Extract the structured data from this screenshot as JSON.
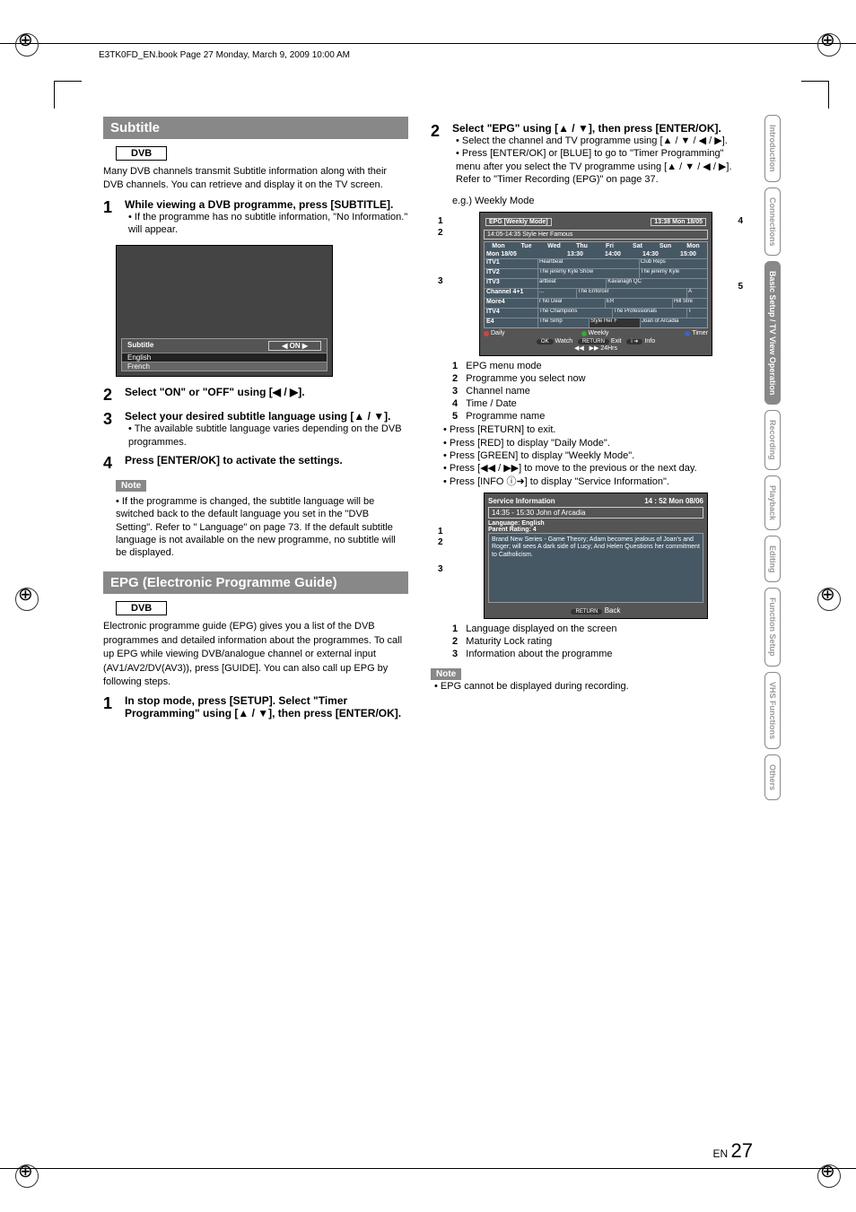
{
  "header": "E3TK0FD_EN.book  Page 27  Monday, March 9, 2009  10:00 AM",
  "left": {
    "section1_title": "Subtitle",
    "dvb": "DVB",
    "intro": "Many DVB channels transmit Subtitle information along with their DVB channels. You can retrieve and display it on the TV screen.",
    "step1_title": "While viewing a DVB programme, press [SUBTITLE].",
    "step1_bullet": "• If the programme has no subtitle information, \"No Information.\" will appear.",
    "sub_box": {
      "label": "Subtitle",
      "on": "ON",
      "rows": [
        "English",
        "French"
      ]
    },
    "step2_title": "Select \"ON\" or \"OFF\" using [◀ / ▶].",
    "step3_title": "Select your desired subtitle language using [▲ / ▼].",
    "step3_bullet": "• The available subtitle language varies depending on the DVB programmes.",
    "step4_title": "Press [ENTER/OK] to activate the settings.",
    "note_label": "Note",
    "note_text": "• If the programme is changed, the subtitle language will be switched back to the default language you set in the \"DVB Setting\". Refer to \"     Language\" on page 73. If the default subtitle language is not available on the new programme, no subtitle will be displayed.",
    "section2_title": "EPG (Electronic Programme Guide)",
    "epg_intro": "Electronic programme guide (EPG) gives you a list of the DVB programmes and detailed information about the programmes. To call up EPG while viewing DVB/analogue channel or external input (AV1/AV2/DV(AV3)), press [GUIDE]. You can also call up EPG by following steps.",
    "epg_step1": "In stop mode, press [SETUP]. Select \"Timer Programming\" using [▲ / ▼], then press [ENTER/OK]."
  },
  "right": {
    "step2_title": "Select \"EPG\" using [▲ / ▼], then press [ENTER/OK].",
    "step2_b1": "• Select the channel and TV programme using [▲ / ▼ / ◀ / ▶].",
    "step2_b2": "• Press [ENTER/OK] or [BLUE] to go to \"Timer Programming\" menu after you select the TV programme using [▲ / ▼ / ◀ / ▶]. Refer to \"Timer Recording (EPG)\" on page 37.",
    "eg_label": "e.g.) Weekly Mode",
    "epg": {
      "title": "EPG [Weekly Mode]",
      "datetime": "13:38 Mon   18/05",
      "selected": "14:05-14:35   Style Her Famous",
      "days": [
        "Mon",
        "Tue",
        "Wed",
        "Thu",
        "Fri",
        "Sat",
        "Sun",
        "Mon"
      ],
      "date_row": "Mon  18/05",
      "times": [
        "13:30",
        "14:00",
        "14:30",
        "15:00"
      ],
      "channels": [
        "ITV1",
        "ITV2",
        "ITV3",
        "Channel 4+1",
        "More4",
        "ITV4",
        "E4"
      ],
      "progs": {
        "ITV1": [
          "Heartbeat",
          "Club Reps"
        ],
        "ITV2": [
          "The jeremy Kyle Show",
          "The jeremy Kyle"
        ],
        "ITV3": [
          "artbeat",
          "Kavanagh QC"
        ],
        "Channel4+1": [
          "...",
          "The Enforcer",
          "A"
        ],
        "More4": [
          "r No Deal",
          "ER",
          "Hill Stre"
        ],
        "ITV4": [
          "The Champions",
          "The Professionals",
          "T"
        ],
        "E4": [
          "The Simp",
          "Style Her F",
          "Joan of Arcadia"
        ]
      },
      "daily": "Daily",
      "weekly": "Weekly",
      "timer": "Timer",
      "watch": "Watch",
      "ok": "OK",
      "return": "RETURN",
      "exit": "Exit",
      "info_btn": "i ➜",
      "info": "Info",
      "hrs": "24Hrs"
    },
    "pointers": {
      "p1": "1",
      "p2": "2",
      "p3": "3",
      "p4": "4",
      "p5": "5"
    },
    "legend": {
      "l1": "EPG menu mode",
      "l2": "Programme you select now",
      "l3": "Channel name",
      "l4": "Time / Date",
      "l5": "Programme name"
    },
    "bullets": [
      "• Press [RETURN] to exit.",
      "• Press [RED] to display \"Daily Mode\".",
      "• Press [GREEN] to display \"Weekly Mode\".",
      "• Press [◀◀ / ▶▶] to move to the previous or the next day.",
      "• Press [INFO ⓘ➜] to display \"Service Information\"."
    ],
    "service": {
      "title": "Service Information",
      "datetime": "14 : 52   Mon   08/06",
      "sel": "14:35 - 15:30   John of Arcadia",
      "lang": "Language: English",
      "rating": "Parent Rating: 4",
      "desc": "Brand New Series - Game Theory;\nAdam becomes jealous of Joan's and Roger; will sees A dark side of Lucy;\nAnd Helen Questions her commitment to Catholicism.",
      "back": "Back",
      "return": "RETURN"
    },
    "service_pointers": {
      "p1": "1",
      "p2": "2",
      "p3": "3"
    },
    "legend2": {
      "l1": "Language displayed on the screen",
      "l2": "Maturity Lock rating",
      "l3": "Information about the programme"
    },
    "note_label": "Note",
    "note2": "• EPG cannot be displayed during recording."
  },
  "tabs": [
    "Introduction",
    "Connections",
    "Basic Setup / TV View Operation",
    "Recording",
    "Playback",
    "Editing",
    "Function Setup",
    "VHS Functions",
    "Others"
  ],
  "page_num_prefix": "EN",
  "page_num": "27"
}
